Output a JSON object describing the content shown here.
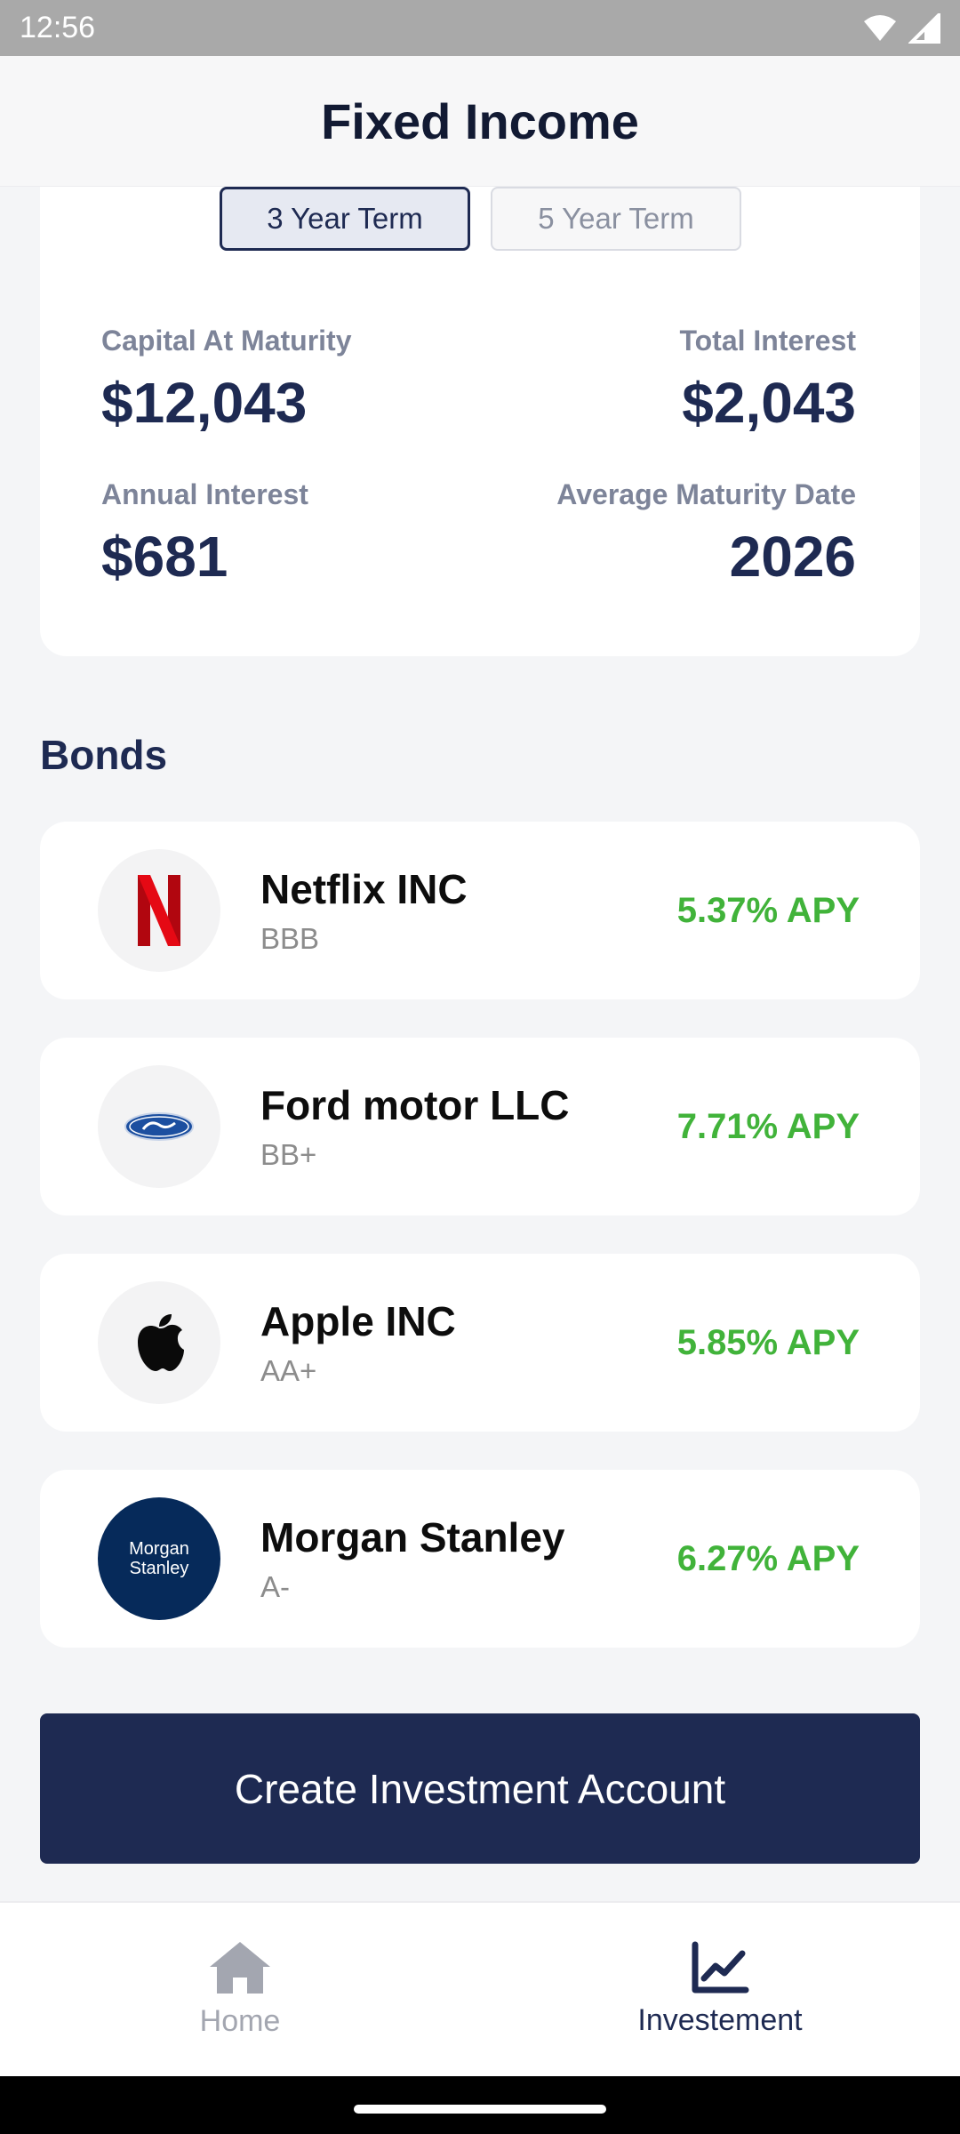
{
  "status_bar": {
    "time": "12:56"
  },
  "header": {
    "title": "Fixed Income"
  },
  "term_tabs": [
    {
      "label": "3 Year Term",
      "selected": true
    },
    {
      "label": "5 Year Term",
      "selected": false
    }
  ],
  "summary": {
    "capital_at_maturity": {
      "label": "Capital At Maturity",
      "value": "$12,043"
    },
    "total_interest": {
      "label": "Total Interest",
      "value": "$2,043"
    },
    "annual_interest": {
      "label": "Annual Interest",
      "value": "$681"
    },
    "average_maturity_date": {
      "label": "Average Maturity Date",
      "value": "2026"
    }
  },
  "bonds_section": {
    "title": "Bonds",
    "items": [
      {
        "name": "Netflix INC",
        "rating": "BBB",
        "apy": "5.37% APY",
        "logo": "netflix-logo"
      },
      {
        "name": "Ford motor LLC",
        "rating": "BB+",
        "apy": "7.71% APY",
        "logo": "ford-logo"
      },
      {
        "name": "Apple INC",
        "rating": "AA+",
        "apy": "5.85% APY",
        "logo": "apple-logo"
      },
      {
        "name": "Morgan Stanley",
        "rating": "A-",
        "apy": "6.27% APY",
        "logo": "morgan-stanley-logo",
        "logo_text": "Morgan Stanley"
      }
    ]
  },
  "cta": {
    "label": "Create Investment Account"
  },
  "bottom_nav": {
    "items": [
      {
        "label": "Home",
        "icon": "home-icon",
        "active": false
      },
      {
        "label": "Investement",
        "icon": "chart-line-icon",
        "active": true
      }
    ]
  },
  "colors": {
    "primary": "#1e2a52",
    "apy_green": "#41b33a",
    "muted_label": "#7d8499"
  }
}
